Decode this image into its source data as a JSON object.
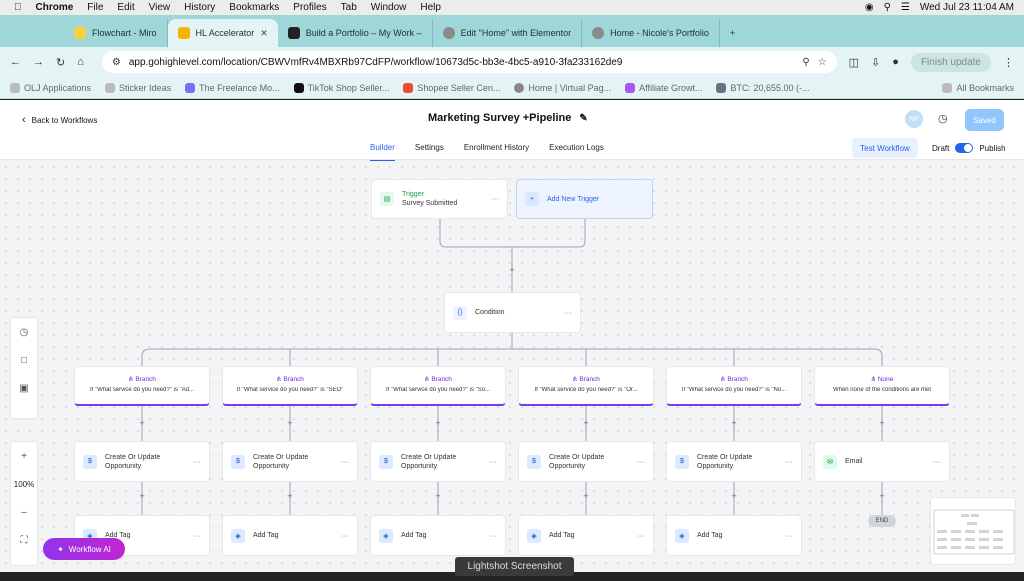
{
  "menubar": {
    "app": "Chrome",
    "items": [
      "File",
      "Edit",
      "View",
      "History",
      "Bookmarks",
      "Profiles",
      "Tab",
      "Window",
      "Help"
    ],
    "clock": "Wed Jul 23  11:04 AM"
  },
  "tabs": [
    {
      "label": "Flowchart - Miro",
      "color": "#f9d13e"
    },
    {
      "label": "HL Accelerator",
      "color": "#f4b400",
      "active": true
    },
    {
      "label": "Build a Portfolio – My Work –",
      "color": "#222222"
    },
    {
      "label": "Edit \"Home\" with Elementor",
      "color": "#8a8a8a"
    },
    {
      "label": "Home - Nicole's Portfolio",
      "color": "#8a8a8a"
    }
  ],
  "toolbar": {
    "url": "app.gohighlevel.com/location/CBWVmfRv4MBXRb97CdFP/workflow/10673d5c-bb3e-4bc5-a910-3fa233162de9",
    "finish_update": "Finish update"
  },
  "bookmarks": [
    "OLJ Applications",
    "Sticker Ideas",
    "The Freelance Mo...",
    "TikTok Shop Seller...",
    "Shopee Seller Cen...",
    "Home | Virtual Pag...",
    "Affiliate Growt...",
    "BTC: 20,655.00 (-..."
  ],
  "bookmarks_all": "All Bookmarks",
  "header": {
    "back": "Back to Workflows",
    "title": "Marketing Survey +Pipeline",
    "avatar": "NP",
    "saved": "Saved",
    "tabs": [
      "Builder",
      "Settings",
      "Enrollment History",
      "Execution Logs"
    ],
    "test_workflow": "Test Workflow",
    "draft": "Draft",
    "publish": "Publish"
  },
  "flow": {
    "trigger_type": "Trigger",
    "trigger_name": "Survey Submitted",
    "add_trigger": "Add New Trigger",
    "condition": "Condition",
    "branches": [
      {
        "title": "Branch",
        "desc": "If \"What service do you need?\" is \"Ad..."
      },
      {
        "title": "Branch",
        "desc": "If \"What service do you need?\" is \"SEO\""
      },
      {
        "title": "Branch",
        "desc": "If \"What service do you need?\" is \"So..."
      },
      {
        "title": "Branch",
        "desc": "If \"What service do you need?\" is \"Or..."
      },
      {
        "title": "Branch",
        "desc": "If \"What service do you need?\" is \"No..."
      },
      {
        "title": "None",
        "desc": "When none of the conditions are met"
      }
    ],
    "actions": [
      "Create Or Update Opportunity",
      "Create Or Update Opportunity",
      "Create Or Update Opportunity",
      "Create Or Update Opportunity",
      "Create Or Update Opportunity",
      "Email"
    ],
    "tags": [
      "Add Tag",
      "Add Tag",
      "Add Tag",
      "Add Tag",
      "Add Tag"
    ],
    "end": "END"
  },
  "zoom": "100%",
  "workflow_ai": "Workflow AI",
  "lightshot": "Lightshot Screenshot"
}
